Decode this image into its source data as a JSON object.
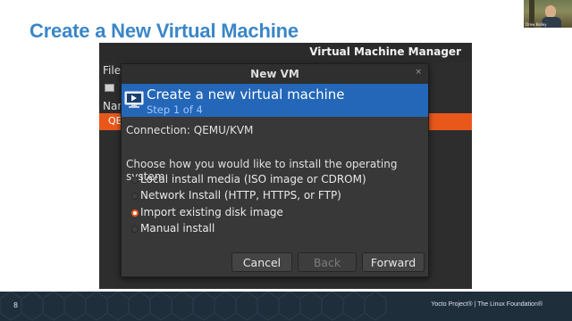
{
  "slide": {
    "title": "Create a New Virtual Machine",
    "page_number": "8",
    "footer_text": "Yocto Project® | The Linux Foundation®"
  },
  "webcam": {
    "name_tag": "Drew Kelley",
    "icon": "webcam-video"
  },
  "vmm": {
    "window_title": "Virtual Machine Manager",
    "menu_file": "File",
    "column_name": "Nam",
    "row_label": "QE"
  },
  "dialog": {
    "title": "New VM",
    "close_glyph": "×",
    "heading": "Create a new virtual machine",
    "step": "Step 1 of 4",
    "connection": "Connection: QEMU/KVM",
    "prompt": "Choose how you would like to install the operating system",
    "options": [
      {
        "label": "Local install media (ISO image or CDROM)",
        "selected": false
      },
      {
        "label": "Network Install (HTTP, HTTPS, or FTP)",
        "selected": false
      },
      {
        "label": "Import existing disk image",
        "selected": true
      },
      {
        "label": "Manual install",
        "selected": false
      }
    ],
    "buttons": {
      "cancel": "Cancel",
      "back": "Back",
      "forward": "Forward"
    }
  },
  "colors": {
    "title_blue": "#3a86c8",
    "banner_blue": "#2466b8",
    "ubuntu_orange": "#e9581b",
    "footer_navy": "#1f2e3b"
  }
}
